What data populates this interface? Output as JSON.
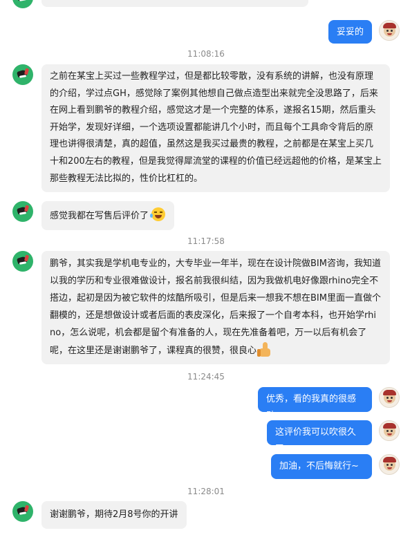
{
  "timestamps": [
    "11:08:16",
    "11:17:58",
    "11:24:45",
    "11:28:01"
  ],
  "messages": {
    "top_partial": "…",
    "m1": "妥妥的",
    "m2": "之前在某宝上买过一些教程学过，但是都比较零散，没有系统的讲解，也没有原理的介绍，学过点GH，感觉除了案例其他想自己做点造型出来就完全没思路了，后来在网上看到鹏爷的教程介绍，感觉这才是一个完整的体系，遂报名15期，然后重头开始学，发现好详细，一个选项设置都能讲几个小时，而且每个工具命令背后的原理也讲得很清楚，真的超值，虽然这是我买过最贵的教程，之前都是在某宝上买几十和200左右的教程，但是我觉得犀流堂的课程的价值已经远超他的价格，是某宝上那些教程无法比拟的，性价比杠杠的。",
    "m3": "感觉我都在写售后评价了",
    "m4": "鹏爷，其实我是学机电专业的，大专毕业一年半，现在在设计院做BIM咨询，我知道以我的学历和专业很难做设计，报名前我很纠结，因为我做机电好像跟rhino完全不搭边，起初是因为被它软件的炫酷所吸引，但是后来一想我不想在BIM里面一直做个翻模的，还是想做设计或者后面的表皮深化，后来报了一个自考本科，也开始学rhino，怎么说呢，机会都是留个有准备的人，现在先准备着吧，万一以后有机会了呢，在这里还是谢谢鹏爷了，课程真的很赞，很良心",
    "m5": "优秀，看的我真的很感动",
    "m6": "这评价我可以吹很久了",
    "m7": "加油，不后悔就行~~",
    "m8": "谢谢鹏爷，期待2月8号你的开讲"
  },
  "emojis": {
    "laugh": "laugh-cry-emoji",
    "thumb": "thumbs-up-emoji"
  },
  "colors": {
    "outgoing_bubble": "#2a7ef4",
    "incoming_bubble": "#f1f1f1",
    "timestamp": "#8a8a8a"
  }
}
